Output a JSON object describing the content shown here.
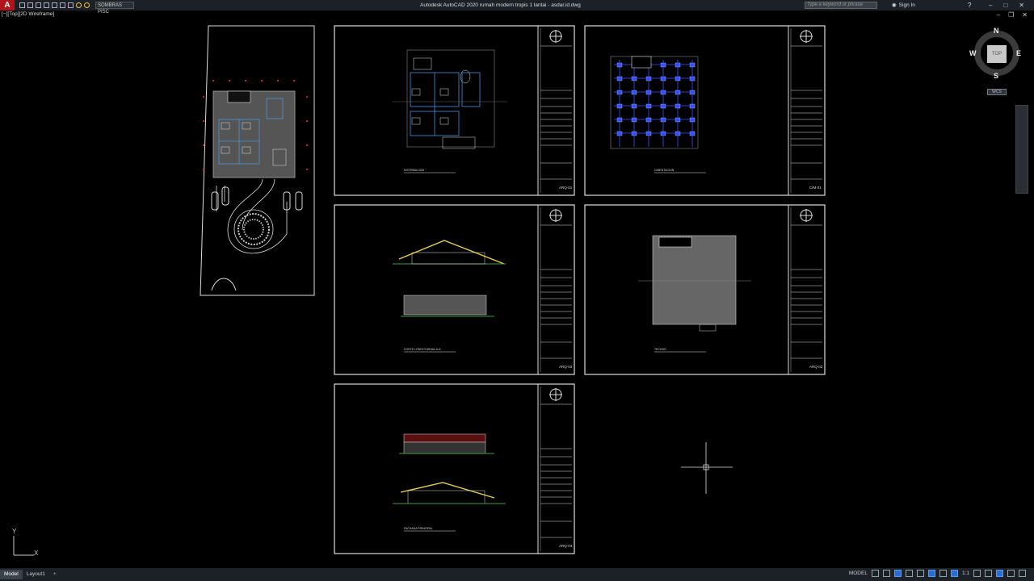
{
  "app": {
    "logo": "A",
    "layer_name": "SOMBRAS PISC",
    "title": "Autodesk AutoCAD 2020   rumah modern tropis 1 lantai - asdar.id.dwg",
    "search_placeholder": "Type a keyword or phrase",
    "sign_in": "Sign In",
    "help": "?"
  },
  "viewport": {
    "label": "[−][Top][2D Wireframe]"
  },
  "viewcube": {
    "north": "N",
    "south": "S",
    "east": "E",
    "west": "W",
    "top": "TOP",
    "wcs": "WCS"
  },
  "sheets": [
    {
      "code": "ARQ-01",
      "label": "DISTRIBUCION"
    },
    {
      "code": "CIM-01",
      "label": "CIMENTACION"
    },
    {
      "code": "ARQ-03",
      "label": "CORTE LONGITUDINAL A-A"
    },
    {
      "code": "ARQ-02",
      "label": "TECHOS"
    },
    {
      "code": "ARQ-04",
      "label": "FACHADA PRINCIPAL"
    }
  ],
  "status": {
    "tabs": [
      "Model",
      "Layout1",
      "+"
    ],
    "model": "MODEL",
    "scale": "1:1"
  }
}
